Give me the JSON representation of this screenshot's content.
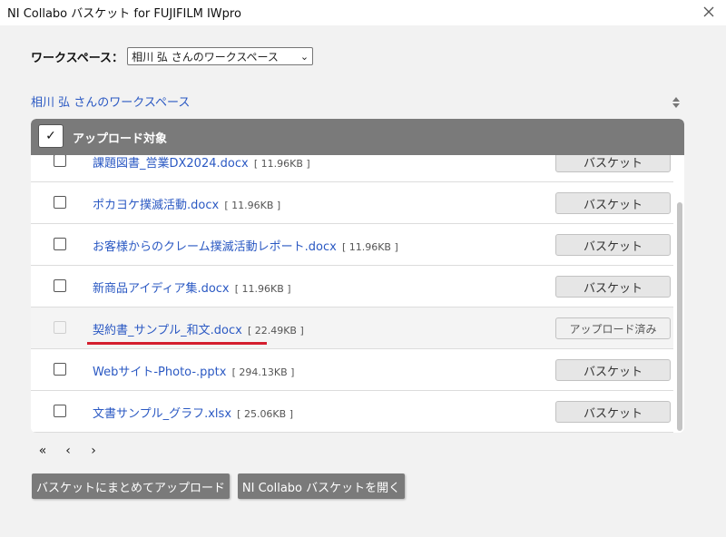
{
  "window": {
    "title": "NI Collabo バスケット for FUJIFILM IWpro"
  },
  "workspace": {
    "label": "ワークスペース：",
    "selected": "相川 弘 さんのワークスペース"
  },
  "breadcrumb": "相川 弘 さんのワークスペース",
  "panel": {
    "header_label": "アップロード対象",
    "header_check": "✓"
  },
  "files": [
    {
      "name": "課題図書_営業DX2024.docx",
      "size": "[ 11.96KB ]",
      "action": "バスケット",
      "uploaded": false
    },
    {
      "name": "ポカヨケ撲滅活動.docx",
      "size": "[ 11.96KB ]",
      "action": "バスケット",
      "uploaded": false
    },
    {
      "name": "お客様からのクレーム撲滅活動レポート.docx",
      "size": "[ 11.96KB ]",
      "action": "バスケット",
      "uploaded": false
    },
    {
      "name": "新商品アイディア集.docx",
      "size": "[ 11.96KB ]",
      "action": "バスケット",
      "uploaded": false
    },
    {
      "name": "契約書_サンプル_和文.docx",
      "size": "[ 22.49KB ]",
      "action": "アップロード済み",
      "uploaded": true
    },
    {
      "name": "Webサイト-Photo-.pptx",
      "size": "[ 294.13KB ]",
      "action": "バスケット",
      "uploaded": false
    },
    {
      "name": "文書サンプル_グラフ.xlsx",
      "size": "[ 25.06KB ]",
      "action": "バスケット",
      "uploaded": false
    }
  ],
  "pager": {
    "first": "«",
    "prev": "‹",
    "next": "›"
  },
  "actions": {
    "upload_all": "バスケットにまとめてアップロード",
    "open_basket": "NI Collabo バスケットを開く"
  },
  "colors": {
    "accent_link": "#2b59c3",
    "header_bg": "#7a7a7a",
    "highlight": "#d41e2e"
  }
}
